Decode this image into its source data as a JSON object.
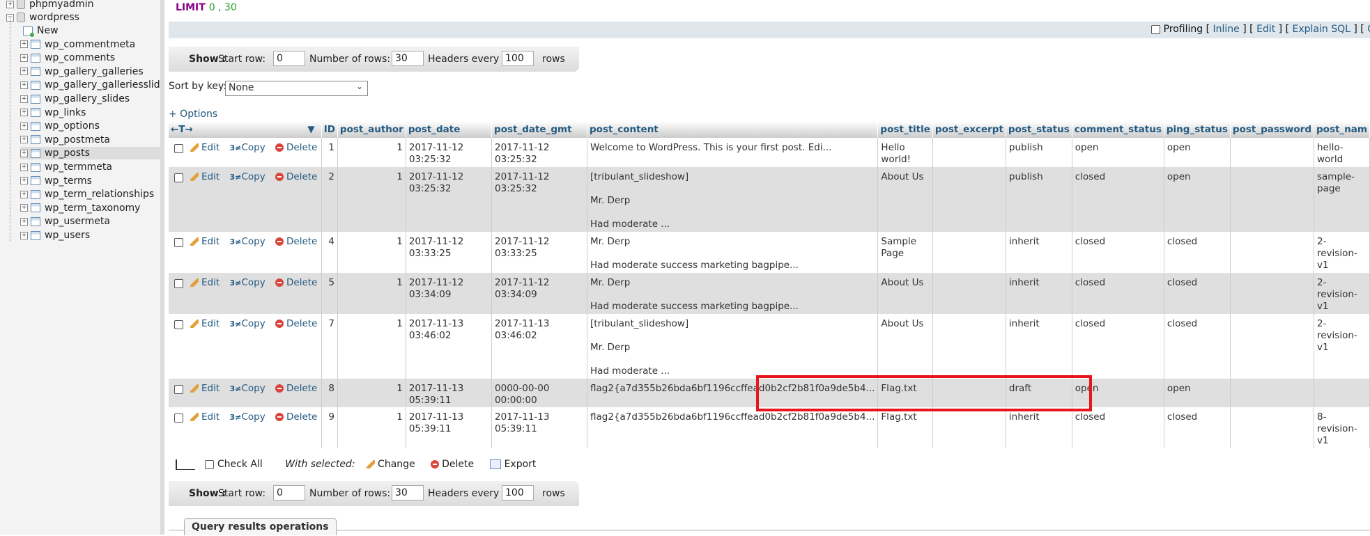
{
  "sidebar": {
    "items": [
      {
        "label": "phpmyadmin",
        "kind": "db"
      },
      {
        "label": "wordpress",
        "kind": "db"
      },
      {
        "label": "New",
        "kind": "new"
      },
      {
        "label": "wp_commentmeta",
        "kind": "table"
      },
      {
        "label": "wp_comments",
        "kind": "table"
      },
      {
        "label": "wp_gallery_galleries",
        "kind": "table"
      },
      {
        "label": "wp_gallery_galleriesslides",
        "kind": "table"
      },
      {
        "label": "wp_gallery_slides",
        "kind": "table"
      },
      {
        "label": "wp_links",
        "kind": "table"
      },
      {
        "label": "wp_options",
        "kind": "table"
      },
      {
        "label": "wp_postmeta",
        "kind": "table"
      },
      {
        "label": "wp_posts",
        "kind": "table",
        "selected": true
      },
      {
        "label": "wp_termmeta",
        "kind": "table"
      },
      {
        "label": "wp_terms",
        "kind": "table"
      },
      {
        "label": "wp_term_relationships",
        "kind": "table"
      },
      {
        "label": "wp_term_taxonomy",
        "kind": "table"
      },
      {
        "label": "wp_usermeta",
        "kind": "table"
      },
      {
        "label": "wp_users",
        "kind": "table"
      }
    ]
  },
  "query": {
    "limit_keyword": "LIMIT",
    "limit_values": "0 , 30"
  },
  "profiling": {
    "label": "Profiling",
    "links": [
      "Inline",
      "Edit",
      "Explain SQL",
      "C"
    ],
    "open_bracket": "[",
    "close_bracket": "]"
  },
  "show_bar": {
    "show_label": "Show :",
    "start_row_label": "Start row:",
    "start_row_value": "0",
    "num_rows_label": "Number of rows:",
    "num_rows_value": "30",
    "headers_every_label": "Headers every",
    "headers_every_value": "100",
    "rows_label": "rows"
  },
  "sort": {
    "label": "Sort by key:",
    "selected": "None"
  },
  "options_link": "+ Options",
  "table": {
    "columns": [
      "",
      "ID",
      "post_author",
      "post_date",
      "post_date_gmt",
      "post_content",
      "post_title",
      "post_excerpt",
      "post_status",
      "comment_status",
      "ping_status",
      "post_password",
      "post_nam"
    ],
    "column_nav": "←T→",
    "actions": {
      "edit": "Edit",
      "copy": "Copy",
      "delete": "Delete"
    },
    "rows": [
      {
        "id": "1",
        "author": "1",
        "date": "2017-11-12 03:25:32",
        "date_gmt": "2017-11-12 03:25:32",
        "content": "Welcome to WordPress. This is your first post. Edi...",
        "title": "Hello\nworld!",
        "excerpt": "",
        "status": "publish",
        "comment_status": "open",
        "ping_status": "open",
        "password": "",
        "name": "hello-world"
      },
      {
        "id": "2",
        "author": "1",
        "date": "2017-11-12 03:25:32",
        "date_gmt": "2017-11-12 03:25:32",
        "content": "[tribulant_slideshow]\n\nMr. Derp\n\nHad moderate ...",
        "title": "About Us",
        "excerpt": "",
        "status": "publish",
        "comment_status": "closed",
        "ping_status": "open",
        "password": "",
        "name": "sample-\npage"
      },
      {
        "id": "4",
        "author": "1",
        "date": "2017-11-12 03:33:25",
        "date_gmt": "2017-11-12 03:33:25",
        "content": "Mr. Derp\n\nHad moderate success marketing bagpipe...",
        "title": "Sample\nPage",
        "excerpt": "",
        "status": "inherit",
        "comment_status": "closed",
        "ping_status": "closed",
        "password": "",
        "name": "2-revision-\nv1"
      },
      {
        "id": "5",
        "author": "1",
        "date": "2017-11-12 03:34:09",
        "date_gmt": "2017-11-12 03:34:09",
        "content": "Mr. Derp\n\nHad moderate success marketing bagpipe...",
        "title": "About Us",
        "excerpt": "",
        "status": "inherit",
        "comment_status": "closed",
        "ping_status": "closed",
        "password": "",
        "name": "2-revision-\nv1"
      },
      {
        "id": "7",
        "author": "1",
        "date": "2017-11-13 03:46:02",
        "date_gmt": "2017-11-13 03:46:02",
        "content": "[tribulant_slideshow]\n\nMr. Derp\n\nHad moderate ...",
        "title": "About Us",
        "excerpt": "",
        "status": "inherit",
        "comment_status": "closed",
        "ping_status": "closed",
        "password": "",
        "name": "2-revision-\nv1"
      },
      {
        "id": "8",
        "author": "1",
        "date": "2017-11-13 05:39:11",
        "date_gmt": "0000-00-00 00:00:00",
        "content": "flag2{a7d355b26bda6bf1196ccffead0b2cf2b81f0a9de5b4...",
        "title": "Flag.txt",
        "excerpt": "",
        "status": "draft",
        "comment_status": "open",
        "ping_status": "open",
        "password": "",
        "name": ""
      },
      {
        "id": "9",
        "author": "1",
        "date": "2017-11-13 05:39:11",
        "date_gmt": "2017-11-13 05:39:11",
        "content": "flag2{a7d355b26bda6bf1196ccffead0b2cf2b81f0a9de5b4...",
        "title": "Flag.txt",
        "excerpt": "",
        "status": "inherit",
        "comment_status": "closed",
        "ping_status": "closed",
        "password": "",
        "name": "8-revision-\nv1"
      }
    ]
  },
  "with_selected": {
    "check_all": "Check All",
    "label": "With selected:",
    "change": "Change",
    "delete": "Delete",
    "export": "Export"
  },
  "query_results_operations": "Query results operations"
}
